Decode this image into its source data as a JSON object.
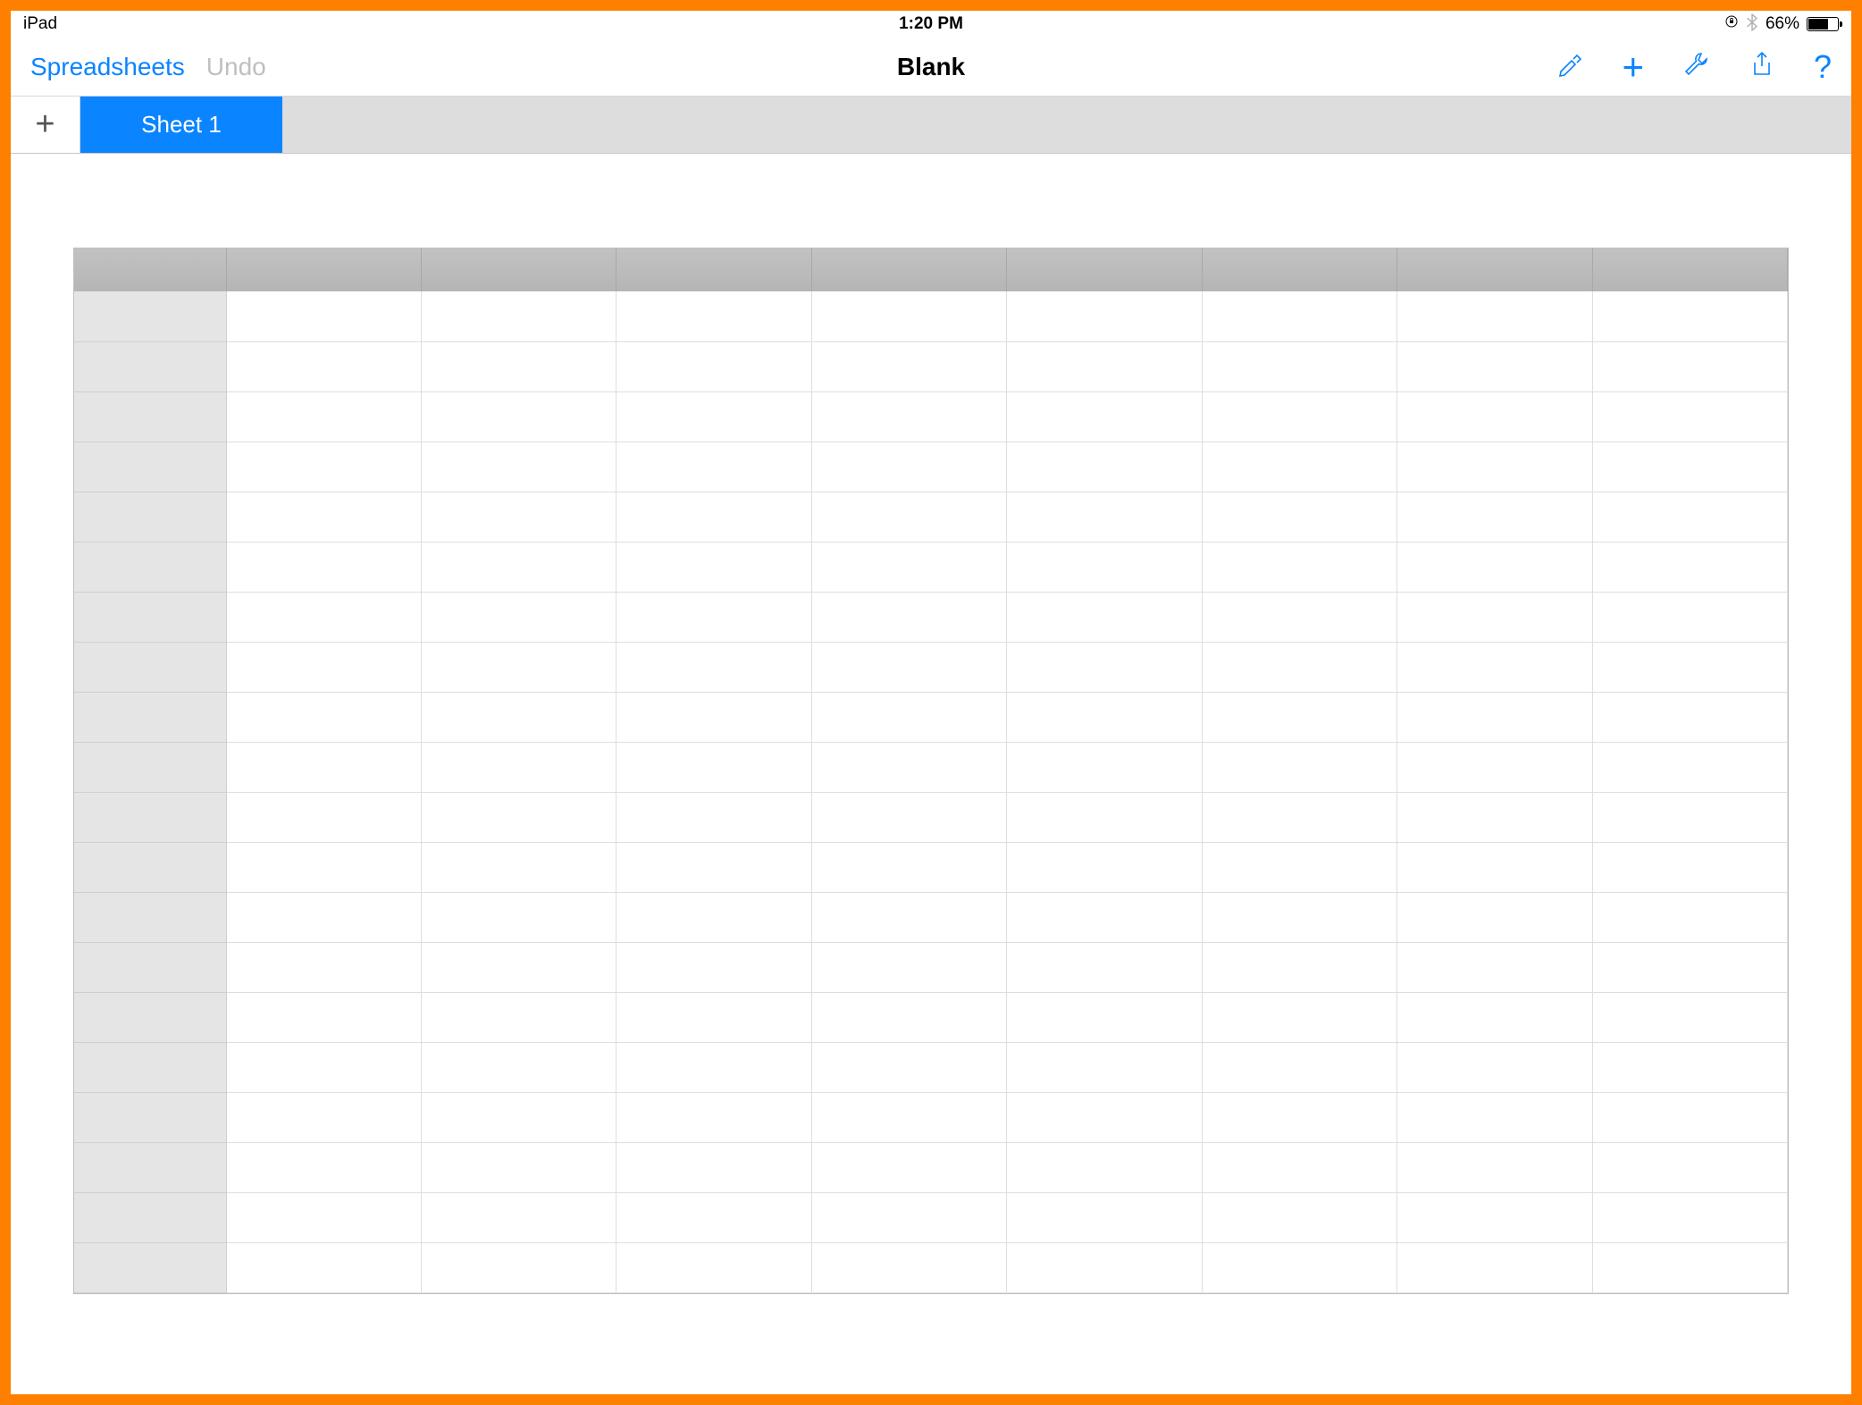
{
  "statusbar": {
    "device": "iPad",
    "time": "1:20 PM",
    "battery_percent": "66%"
  },
  "toolbar": {
    "back_label": "Spreadsheets",
    "undo_label": "Undo",
    "title": "Blank"
  },
  "tabs": {
    "active_label": "Sheet 1"
  },
  "grid": {
    "columns": 9,
    "rows": 20
  }
}
